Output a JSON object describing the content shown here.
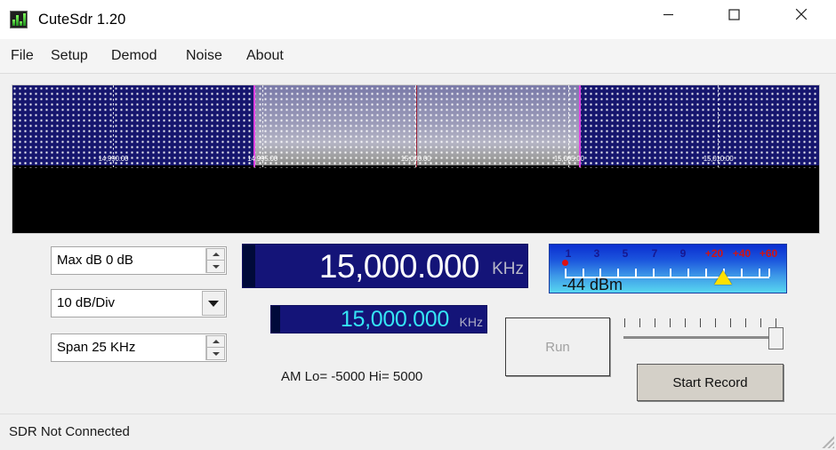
{
  "window": {
    "title": "CuteSdr 1.20",
    "icon": "spectrum-bars-icon",
    "minimize_label": "—",
    "maximize_label": "□",
    "close_label": "✕"
  },
  "menubar": {
    "items": [
      {
        "label": "File"
      },
      {
        "label": "Setup"
      },
      {
        "label": "Demod"
      },
      {
        "label": "Noise"
      },
      {
        "label": "About"
      }
    ]
  },
  "spectrum": {
    "background_color": "#000000",
    "noise_floor_color": "#16166e",
    "passband_color": "#b4b4c4",
    "filter_edge_color": "#e040e0",
    "center_line_color": "#961428",
    "freq_labels": [
      {
        "text": "14,990.00",
        "x_pct": 12.5
      },
      {
        "text": "14,995.00",
        "x_pct": 31.0
      },
      {
        "text": "15,000.00",
        "x_pct": 50.0
      },
      {
        "text": "15,005.00",
        "x_pct": 69.0
      },
      {
        "text": "15,010.00",
        "x_pct": 87.5
      }
    ]
  },
  "controls": {
    "max_db": {
      "label": "Max dB 0 dB",
      "type": "spinbox"
    },
    "db_per_div": {
      "label": "10 dB/Div",
      "type": "combobox"
    },
    "span": {
      "label": "Span 25 KHz",
      "type": "spinbox"
    }
  },
  "frequency": {
    "main_value": "15,000.000",
    "main_unit": "KHz",
    "sub_value": "15,000.000",
    "sub_unit": "KHz",
    "main_color": "#ffffff",
    "sub_color": "#35e5f5",
    "display_background": "#141478"
  },
  "filter_info": {
    "text": "AM Lo= -5000 Hi= 5000"
  },
  "smeter": {
    "s_labels": [
      "1",
      "3",
      "5",
      "7",
      "9"
    ],
    "plus_labels": [
      "+20",
      "+40",
      "+60"
    ],
    "value": "-44 dBm",
    "s_label_color": "#17178f",
    "plus_label_color": "#d01414",
    "pointer_color": "#ffe000",
    "dot_color": "#e01010"
  },
  "buttons": {
    "run": {
      "label": "Run",
      "enabled": false
    },
    "record": {
      "label": "Start Record",
      "enabled": true
    }
  },
  "volume_slider": {
    "value": 100,
    "min": 0,
    "max": 100,
    "tick_count": 11
  },
  "statusbar": {
    "text": "SDR Not Connected"
  }
}
